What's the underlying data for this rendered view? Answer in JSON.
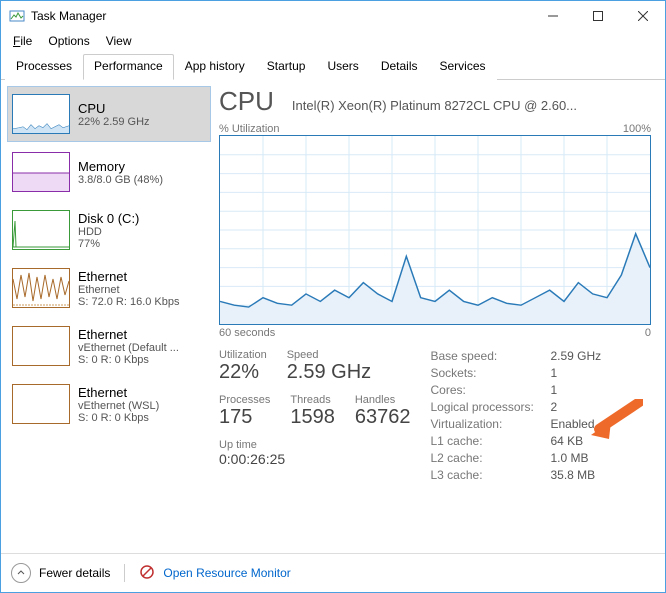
{
  "titlebar": {
    "title": "Task Manager"
  },
  "menu": {
    "file": "File",
    "options": "Options",
    "view": "View"
  },
  "tabs": [
    "Processes",
    "Performance",
    "App history",
    "Startup",
    "Users",
    "Details",
    "Services"
  ],
  "activeTab": "Performance",
  "sidebar": [
    {
      "title": "CPU",
      "sub": "22% 2.59 GHz",
      "color": "#2a7ab8"
    },
    {
      "title": "Memory",
      "sub": "3.8/8.0 GB (48%)",
      "color": "#8a2da8"
    },
    {
      "title": "Disk 0 (C:)",
      "sub": "HDD",
      "sub2": "77%",
      "color": "#3a9a3a"
    },
    {
      "title": "Ethernet",
      "sub": "Ethernet",
      "sub2": "S: 72.0 R: 16.0 Kbps",
      "color": "#a86a2a"
    },
    {
      "title": "Ethernet",
      "sub": "vEthernet (Default ...",
      "sub2": "S: 0 R: 0 Kbps",
      "color": "#a86a2a"
    },
    {
      "title": "Ethernet",
      "sub": "vEthernet (WSL)",
      "sub2": "S: 0 R: 0 Kbps",
      "color": "#a86a2a"
    }
  ],
  "main": {
    "title": "CPU",
    "subtitle": "Intel(R) Xeon(R) Platinum 8272CL CPU @ 2.60...",
    "chartTopLeft": "% Utilization",
    "chartTopRight": "100%",
    "chartBottomLeft": "60 seconds",
    "chartBottomRight": "0",
    "stats": {
      "utilization": {
        "label": "Utilization",
        "value": "22%"
      },
      "speed": {
        "label": "Speed",
        "value": "2.59 GHz"
      },
      "processes": {
        "label": "Processes",
        "value": "175"
      },
      "threads": {
        "label": "Threads",
        "value": "1598"
      },
      "handles": {
        "label": "Handles",
        "value": "63762"
      },
      "uptime": {
        "label": "Up time",
        "value": "0:00:26:25"
      }
    },
    "kv": [
      {
        "k": "Base speed:",
        "v": "2.59 GHz"
      },
      {
        "k": "Sockets:",
        "v": "1"
      },
      {
        "k": "Cores:",
        "v": "1"
      },
      {
        "k": "Logical processors:",
        "v": "2"
      },
      {
        "k": "Virtualization:",
        "v": "Enabled"
      },
      {
        "k": "L1 cache:",
        "v": "64 KB"
      },
      {
        "k": "L2 cache:",
        "v": "1.0 MB"
      },
      {
        "k": "L3 cache:",
        "v": "35.8 MB"
      }
    ]
  },
  "footer": {
    "fewer": "Fewer details",
    "orm": "Open Resource Monitor"
  },
  "chart_data": {
    "type": "line",
    "title": "% Utilization",
    "xlabel": "60 seconds",
    "ylabel": "% Utilization",
    "xlim": [
      0,
      60
    ],
    "ylim": [
      0,
      100
    ],
    "x": [
      0,
      2,
      4,
      6,
      8,
      10,
      12,
      14,
      16,
      18,
      20,
      22,
      24,
      26,
      28,
      30,
      32,
      34,
      36,
      38,
      40,
      42,
      44,
      46,
      48,
      50,
      52,
      54,
      56,
      58,
      60
    ],
    "values": [
      12,
      10,
      9,
      14,
      11,
      10,
      16,
      12,
      18,
      14,
      22,
      16,
      12,
      36,
      14,
      12,
      18,
      12,
      10,
      14,
      11,
      10,
      14,
      18,
      12,
      22,
      16,
      14,
      26,
      48,
      30
    ]
  }
}
